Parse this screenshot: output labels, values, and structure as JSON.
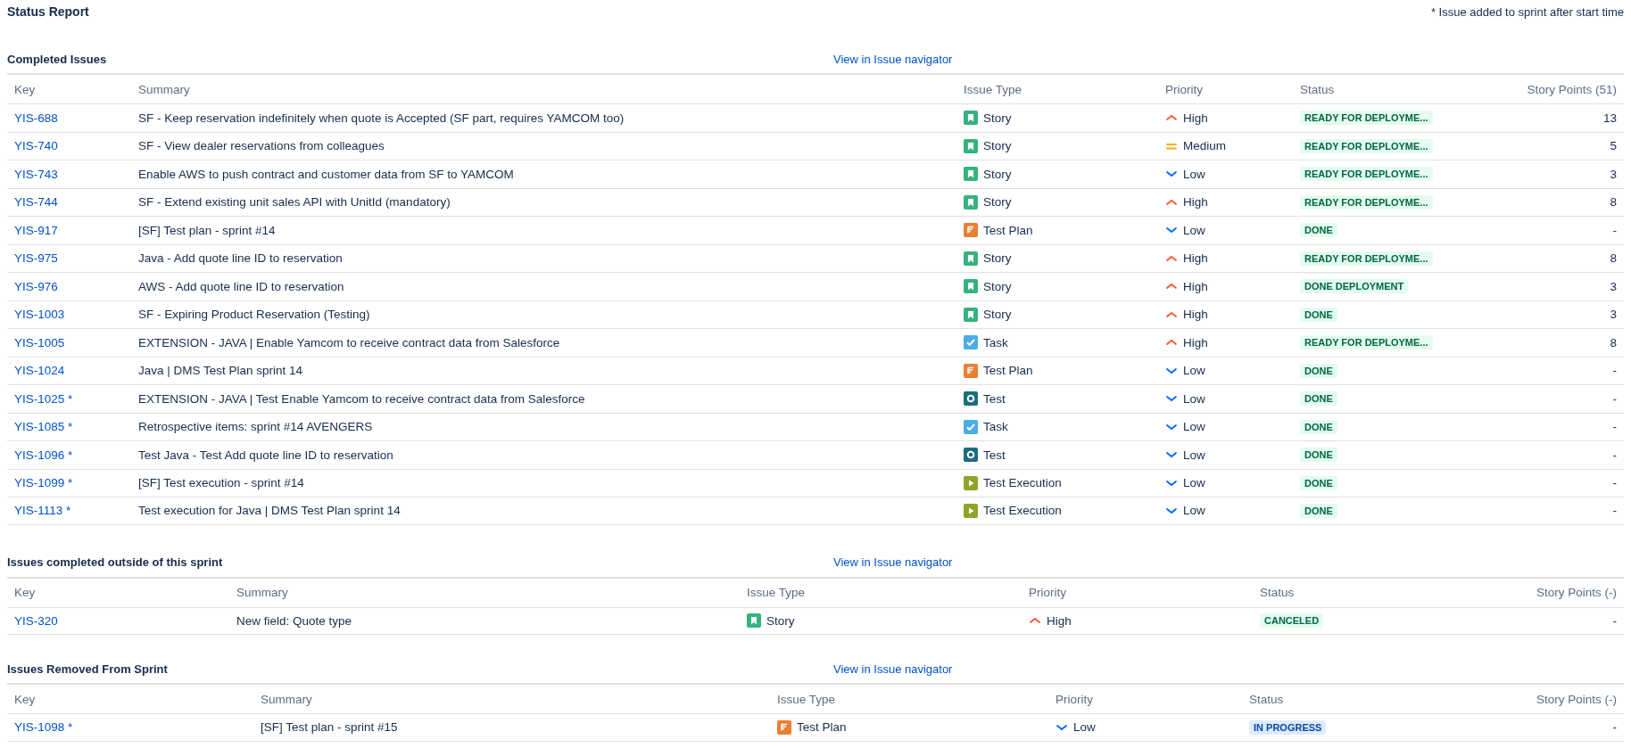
{
  "title": "Status Report",
  "note": "* Issue added to sprint after start time",
  "sections": [
    {
      "heading": "Completed Issues",
      "link": "View in Issue navigator",
      "columns": [
        "Key",
        "Summary",
        "Issue Type",
        "Priority",
        "Status",
        "Story Points (51)"
      ],
      "rows": [
        {
          "key": "YIS-688",
          "summary": "SF - Keep reservation indefinitely when quote is Accepted (SF part, requires YAMCOM too)",
          "type": {
            "label": "Story",
            "kind": "story"
          },
          "priority": {
            "label": "High",
            "kind": "high"
          },
          "status": {
            "label": "READY FOR DEPLOYME...",
            "kind": "done"
          },
          "points": "13"
        },
        {
          "key": "YIS-740",
          "summary": "SF - View dealer reservations from colleagues",
          "type": {
            "label": "Story",
            "kind": "story"
          },
          "priority": {
            "label": "Medium",
            "kind": "medium"
          },
          "status": {
            "label": "READY FOR DEPLOYME...",
            "kind": "done"
          },
          "points": "5"
        },
        {
          "key": "YIS-743",
          "summary": "Enable AWS to push contract and customer data from SF to YAMCOM",
          "type": {
            "label": "Story",
            "kind": "story"
          },
          "priority": {
            "label": "Low",
            "kind": "low"
          },
          "status": {
            "label": "READY FOR DEPLOYME...",
            "kind": "done"
          },
          "points": "3"
        },
        {
          "key": "YIS-744",
          "summary": "SF - Extend existing unit sales API with UnitId (mandatory)",
          "type": {
            "label": "Story",
            "kind": "story"
          },
          "priority": {
            "label": "High",
            "kind": "high"
          },
          "status": {
            "label": "READY FOR DEPLOYME...",
            "kind": "done"
          },
          "points": "8"
        },
        {
          "key": "YIS-917",
          "summary": "[SF] Test plan - sprint #14",
          "type": {
            "label": "Test Plan",
            "kind": "testplan"
          },
          "priority": {
            "label": "Low",
            "kind": "low"
          },
          "status": {
            "label": "DONE",
            "kind": "done"
          },
          "points": "-"
        },
        {
          "key": "YIS-975",
          "summary": "Java - Add quote line ID to reservation",
          "type": {
            "label": "Story",
            "kind": "story"
          },
          "priority": {
            "label": "High",
            "kind": "high"
          },
          "status": {
            "label": "READY FOR DEPLOYME...",
            "kind": "done"
          },
          "points": "8"
        },
        {
          "key": "YIS-976",
          "summary": "AWS - Add quote line ID to reservation",
          "type": {
            "label": "Story",
            "kind": "story"
          },
          "priority": {
            "label": "High",
            "kind": "high"
          },
          "status": {
            "label": "DONE DEPLOYMENT",
            "kind": "done"
          },
          "points": "3"
        },
        {
          "key": "YIS-1003",
          "summary": "SF - Expiring Product Reservation (Testing)",
          "type": {
            "label": "Story",
            "kind": "story"
          },
          "priority": {
            "label": "High",
            "kind": "high"
          },
          "status": {
            "label": "DONE",
            "kind": "done"
          },
          "points": "3"
        },
        {
          "key": "YIS-1005",
          "summary": "EXTENSION - JAVA | Enable Yamcom to receive contract data from Salesforce",
          "type": {
            "label": "Task",
            "kind": "task"
          },
          "priority": {
            "label": "High",
            "kind": "high"
          },
          "status": {
            "label": "READY FOR DEPLOYME...",
            "kind": "done"
          },
          "points": "8"
        },
        {
          "key": "YIS-1024",
          "summary": "Java | DMS Test Plan sprint 14",
          "type": {
            "label": "Test Plan",
            "kind": "testplan"
          },
          "priority": {
            "label": "Low",
            "kind": "low"
          },
          "status": {
            "label": "DONE",
            "kind": "done"
          },
          "points": "-"
        },
        {
          "key": "YIS-1025 *",
          "summary": "EXTENSION - JAVA | Test Enable Yamcom to receive contract data from Salesforce",
          "type": {
            "label": "Test",
            "kind": "test"
          },
          "priority": {
            "label": "Low",
            "kind": "low"
          },
          "status": {
            "label": "DONE",
            "kind": "done"
          },
          "points": "-"
        },
        {
          "key": "YIS-1085 *",
          "summary": "Retrospective items: sprint #14 AVENGERS",
          "type": {
            "label": "Task",
            "kind": "task"
          },
          "priority": {
            "label": "Low",
            "kind": "low"
          },
          "status": {
            "label": "DONE",
            "kind": "done"
          },
          "points": "-"
        },
        {
          "key": "YIS-1096 *",
          "summary": "Test Java - Test Add quote line ID to reservation",
          "type": {
            "label": "Test",
            "kind": "test"
          },
          "priority": {
            "label": "Low",
            "kind": "low"
          },
          "status": {
            "label": "DONE",
            "kind": "done"
          },
          "points": "-"
        },
        {
          "key": "YIS-1099 *",
          "summary": "[SF] Test execution - sprint #14",
          "type": {
            "label": "Test Execution",
            "kind": "testexecution"
          },
          "priority": {
            "label": "Low",
            "kind": "low"
          },
          "status": {
            "label": "DONE",
            "kind": "done"
          },
          "points": "-"
        },
        {
          "key": "YIS-1113 *",
          "summary": "Test execution for Java | DMS Test Plan sprint 14",
          "type": {
            "label": "Test Execution",
            "kind": "testexecution"
          },
          "priority": {
            "label": "Low",
            "kind": "low"
          },
          "status": {
            "label": "DONE",
            "kind": "done"
          },
          "points": "-"
        }
      ]
    },
    {
      "heading": "Issues completed outside of this sprint",
      "link": "View in Issue navigator",
      "columns": [
        "Key",
        "Summary",
        "Issue Type",
        "Priority",
        "Status",
        "Story Points (-)"
      ],
      "rows": [
        {
          "key": "YIS-320",
          "summary": "New field: Quote type",
          "type": {
            "label": "Story",
            "kind": "story"
          },
          "priority": {
            "label": "High",
            "kind": "high"
          },
          "status": {
            "label": "CANCELED",
            "kind": "done"
          },
          "points": "-"
        }
      ]
    },
    {
      "heading": "Issues Removed From Sprint",
      "link": "View in Issue navigator",
      "columns": [
        "Key",
        "Summary",
        "Issue Type",
        "Priority",
        "Status",
        "Story Points (-)"
      ],
      "rows": [
        {
          "key": "YIS-1098 *",
          "summary": "[SF] Test plan - sprint #15",
          "type": {
            "label": "Test Plan",
            "kind": "testplan"
          },
          "priority": {
            "label": "Low",
            "kind": "low"
          },
          "status": {
            "label": "IN PROGRESS",
            "kind": "inprogress"
          },
          "points": "-"
        }
      ]
    }
  ]
}
